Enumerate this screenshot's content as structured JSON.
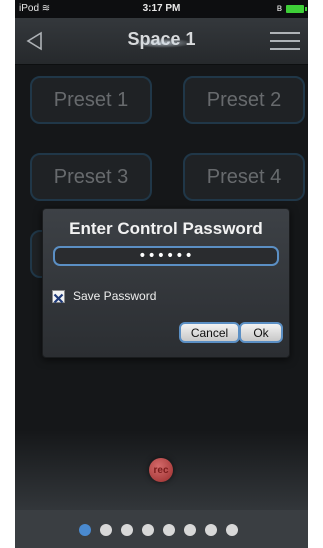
{
  "status_bar": {
    "device": "iPod",
    "time": "3:17 PM"
  },
  "nav": {
    "title": "Space 1"
  },
  "presets": [
    "Preset 1",
    "Preset 2",
    "Preset 3",
    "Preset 4"
  ],
  "dialog": {
    "title": "Enter Control Password",
    "password_masked": "••••••",
    "save_password_label": "Save Password",
    "save_password_checked": true,
    "cancel_label": "Cancel",
    "ok_label": "Ok"
  },
  "record_button": {
    "label": "rec"
  },
  "pager": {
    "page_count": 8,
    "current_page": 1
  },
  "colors": {
    "accent": "#5b8fc4",
    "active_dot": "#4a8ad0",
    "battery": "#3ecf38"
  }
}
